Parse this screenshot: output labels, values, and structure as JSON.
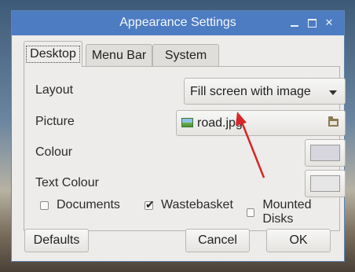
{
  "window": {
    "title": "Appearance Settings",
    "controls": [
      "minimize-icon",
      "maximize-icon",
      "close-icon"
    ]
  },
  "tabs": [
    {
      "label": "Desktop",
      "active": true
    },
    {
      "label": "Menu Bar",
      "active": false
    },
    {
      "label": "System",
      "active": false
    }
  ],
  "desktop": {
    "layout_label": "Layout",
    "layout_value": "Fill screen with image",
    "picture_label": "Picture",
    "picture_value": "road.jpg",
    "colour_label": "Colour",
    "colour_value": "#d7d6df",
    "text_colour_label": "Text Colour",
    "text_colour_value": "#e6e6e6",
    "checkboxes": [
      {
        "label": "Documents",
        "checked": false
      },
      {
        "label": "Wastebasket",
        "checked": true
      },
      {
        "label": "Mounted Disks",
        "checked": false
      }
    ]
  },
  "buttons": {
    "defaults": "Defaults",
    "cancel": "Cancel",
    "ok": "OK"
  },
  "annotation": {
    "color": "#d62728",
    "points_to": "picture-file-button"
  }
}
